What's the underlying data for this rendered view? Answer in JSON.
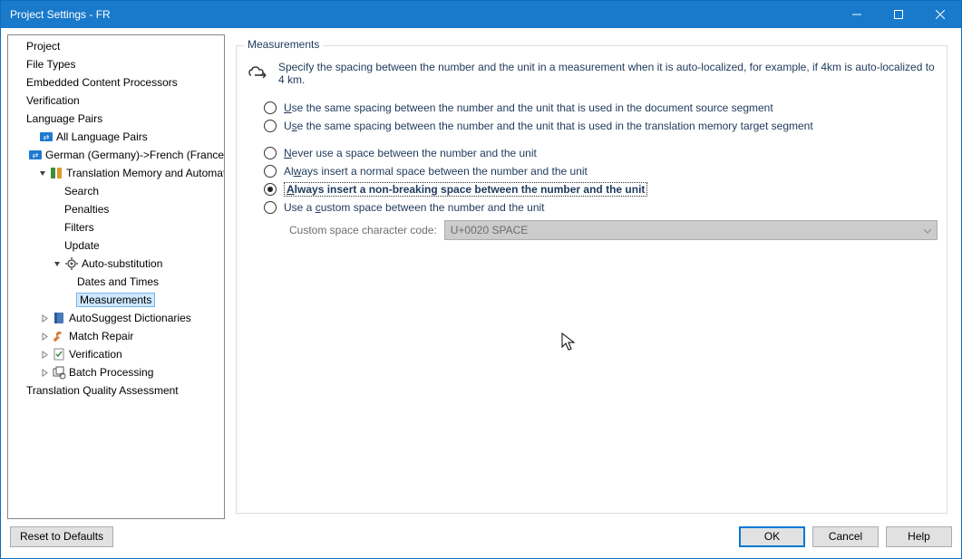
{
  "window": {
    "title": "Project Settings - FR"
  },
  "sidebar": {
    "items": [
      {
        "label": "Project",
        "indent": 0,
        "arrow": "none",
        "icon": "none"
      },
      {
        "label": "File Types",
        "indent": 0,
        "arrow": "none",
        "icon": "none"
      },
      {
        "label": "Embedded Content Processors",
        "indent": 0,
        "arrow": "none",
        "icon": "none"
      },
      {
        "label": "Verification",
        "indent": 0,
        "arrow": "none",
        "icon": "none"
      },
      {
        "label": "Language Pairs",
        "indent": 0,
        "arrow": "none",
        "icon": "none"
      },
      {
        "label": "All Language Pairs",
        "indent": 1,
        "arrow": "none",
        "icon": "lang-all"
      },
      {
        "label": "German (Germany)->French (France)",
        "indent": 1,
        "arrow": "none",
        "icon": "lang-pair"
      },
      {
        "label": "Translation Memory and Automated Translation",
        "indent": 2,
        "arrow": "down",
        "icon": "tm"
      },
      {
        "label": "Search",
        "indent": 3,
        "arrow": "none",
        "icon": "none"
      },
      {
        "label": "Penalties",
        "indent": 3,
        "arrow": "none",
        "icon": "none"
      },
      {
        "label": "Filters",
        "indent": 3,
        "arrow": "none",
        "icon": "none"
      },
      {
        "label": "Update",
        "indent": 3,
        "arrow": "none",
        "icon": "none"
      },
      {
        "label": "Auto-substitution",
        "indent": 3,
        "arrow": "down",
        "icon": "gear"
      },
      {
        "label": "Dates and Times",
        "indent": 4,
        "arrow": "none",
        "icon": "none"
      },
      {
        "label": "Measurements",
        "indent": 4,
        "arrow": "none",
        "icon": "none",
        "selected": true
      },
      {
        "label": "AutoSuggest Dictionaries",
        "indent": 2,
        "arrow": "right",
        "icon": "book"
      },
      {
        "label": "Match Repair",
        "indent": 2,
        "arrow": "right",
        "icon": "wrench"
      },
      {
        "label": "Verification",
        "indent": 2,
        "arrow": "right",
        "icon": "verify"
      },
      {
        "label": "Batch Processing",
        "indent": 2,
        "arrow": "right",
        "icon": "batch"
      },
      {
        "label": "Translation Quality Assessment",
        "indent": 0,
        "arrow": "none",
        "icon": "none"
      }
    ]
  },
  "main": {
    "legend": "Measurements",
    "spec": "Specify the spacing between the number and the unit in a measurement when it is auto-localized, for example, if 4km is auto-localized to 4 km.",
    "radios1": [
      {
        "id": "r1",
        "label": "Use the same spacing between the number and the unit that is used in the document source segment",
        "checked": false,
        "accel": "U"
      },
      {
        "id": "r2",
        "label": "Use the same spacing between the number and the unit that is used in the translation memory target segment",
        "checked": false,
        "accel": "s"
      }
    ],
    "radios2": [
      {
        "id": "r3",
        "label": "Never use a space between the number and the unit",
        "checked": false,
        "accel": "N"
      },
      {
        "id": "r4",
        "label": "Always insert a normal space between the number and the unit",
        "checked": false,
        "accel": "w"
      },
      {
        "id": "r5",
        "label": "Always insert a non-breaking space between the number and the unit",
        "checked": true,
        "accel": "A"
      },
      {
        "id": "r6",
        "label": "Use a custom space between the number and the unit",
        "checked": false,
        "accel": "c"
      }
    ],
    "custom_label": "Custom space character code:",
    "custom_value": "U+0020 SPACE"
  },
  "footer": {
    "reset": "Reset to Defaults",
    "ok": "OK",
    "cancel": "Cancel",
    "help": "Help"
  }
}
